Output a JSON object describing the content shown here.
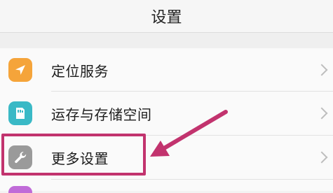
{
  "header": {
    "title": "设置"
  },
  "items": [
    {
      "label": "定位服务",
      "icon": "location-arrow-icon",
      "color": "#f5a43a"
    },
    {
      "label": "运存与存储空间",
      "icon": "storage-icon",
      "color": "#3ab9c6"
    },
    {
      "label": "更多设置",
      "icon": "wrench-icon",
      "color": "#9a9a9a"
    }
  ],
  "partial_item": {
    "color": "#c06bd8"
  },
  "highlight": {
    "color": "#c2336e"
  }
}
